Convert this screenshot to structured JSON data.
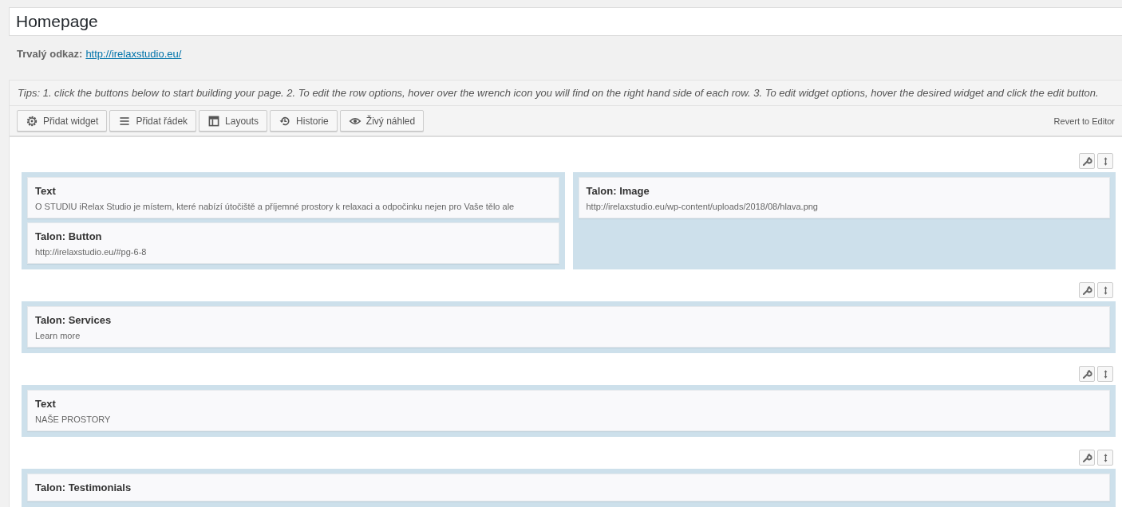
{
  "title_field": {
    "value": "Homepage"
  },
  "permalink": {
    "label": "Trvalý odkaz:",
    "url": "http://irelaxstudio.eu/"
  },
  "tips": "Tips: 1. click the buttons below to start building your page. 2. To edit the row options, hover over the wrench icon you will find on the right hand side of each row. 3. To edit widget options, hover the desired widget and click the edit button.",
  "toolbar": {
    "buttons": [
      {
        "label": "Přidat widget",
        "kind": "widget"
      },
      {
        "label": "Přidat řádek",
        "kind": "row"
      },
      {
        "label": "Layouts",
        "kind": "layouts"
      },
      {
        "label": "Historie",
        "kind": "history"
      },
      {
        "label": "Živý náhled",
        "kind": "preview"
      }
    ],
    "revert": "Revert to Editor"
  },
  "rows": [
    {
      "cells": [
        {
          "widgets": [
            {
              "title": "Text",
              "description": "O STUDIU iRelax Studio je místem, které nabízí útočiště a příjemné prostory k relaxaci a odpočinku nejen pro Vaše tělo ale"
            },
            {
              "title": "Talon: Button",
              "description": "http://irelaxstudio.eu/#pg-6-8"
            }
          ]
        },
        {
          "widgets": [
            {
              "title": "Talon: Image",
              "description": "http://irelaxstudio.eu/wp-content/uploads/2018/08/hlava.png"
            }
          ]
        }
      ]
    },
    {
      "cells": [
        {
          "widgets": [
            {
              "title": "Talon: Services",
              "description": "Learn more"
            }
          ]
        }
      ]
    },
    {
      "cells": [
        {
          "widgets": [
            {
              "title": "Text",
              "description": "NAŠE PROSTORY"
            }
          ]
        }
      ]
    },
    {
      "cells": [
        {
          "widgets": [
            {
              "title": "Talon: Testimonials"
            }
          ]
        }
      ]
    }
  ]
}
